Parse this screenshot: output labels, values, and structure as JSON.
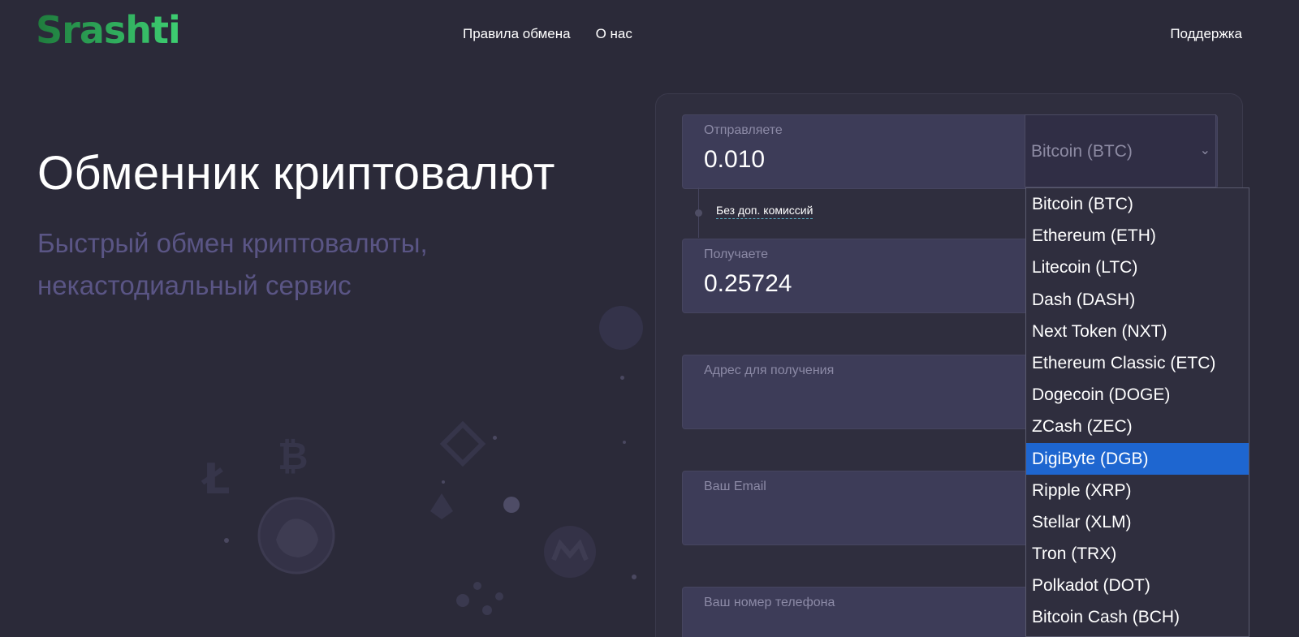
{
  "header": {
    "logo": "Srashti",
    "nav": [
      "Правила обмена",
      "О нас"
    ],
    "support": "Поддержка"
  },
  "hero": {
    "title": "Обменник криптовалют",
    "subtitle": "Быстрый обмен криптовалюты, некастодиальный сервис"
  },
  "form": {
    "send": {
      "label": "Отправляете",
      "value": "0.010"
    },
    "currency_select": {
      "value": "Bitcoin (BTC)"
    },
    "commission": "Без доп. комиссий",
    "receive": {
      "label": "Получаете",
      "value": "0.25724"
    },
    "address": {
      "label": "Адрес для получения"
    },
    "email": {
      "label": "Ваш Email"
    },
    "phone": {
      "label": "Ваш номер телефона"
    }
  },
  "dropdown": {
    "options": [
      "Bitcoin (BTC)",
      "Ethereum (ETH)",
      "Litecoin (LTC)",
      "Dash (DASH)",
      "Next Token (NXT)",
      "Ethereum Classic (ETC)",
      "Dogecoin (DOGE)",
      "ZCash (ZEC)",
      "DigiByte (DGB)",
      "Ripple (XRP)",
      "Stellar (XLM)",
      "Tron (TRX)",
      "Polkadot (DOT)",
      "Bitcoin Cash (BCH)"
    ],
    "selected_index": 8
  },
  "colors": {
    "background": "#2b2a39",
    "accent_green": "#2ea85a",
    "highlight": "#1e66d0"
  }
}
